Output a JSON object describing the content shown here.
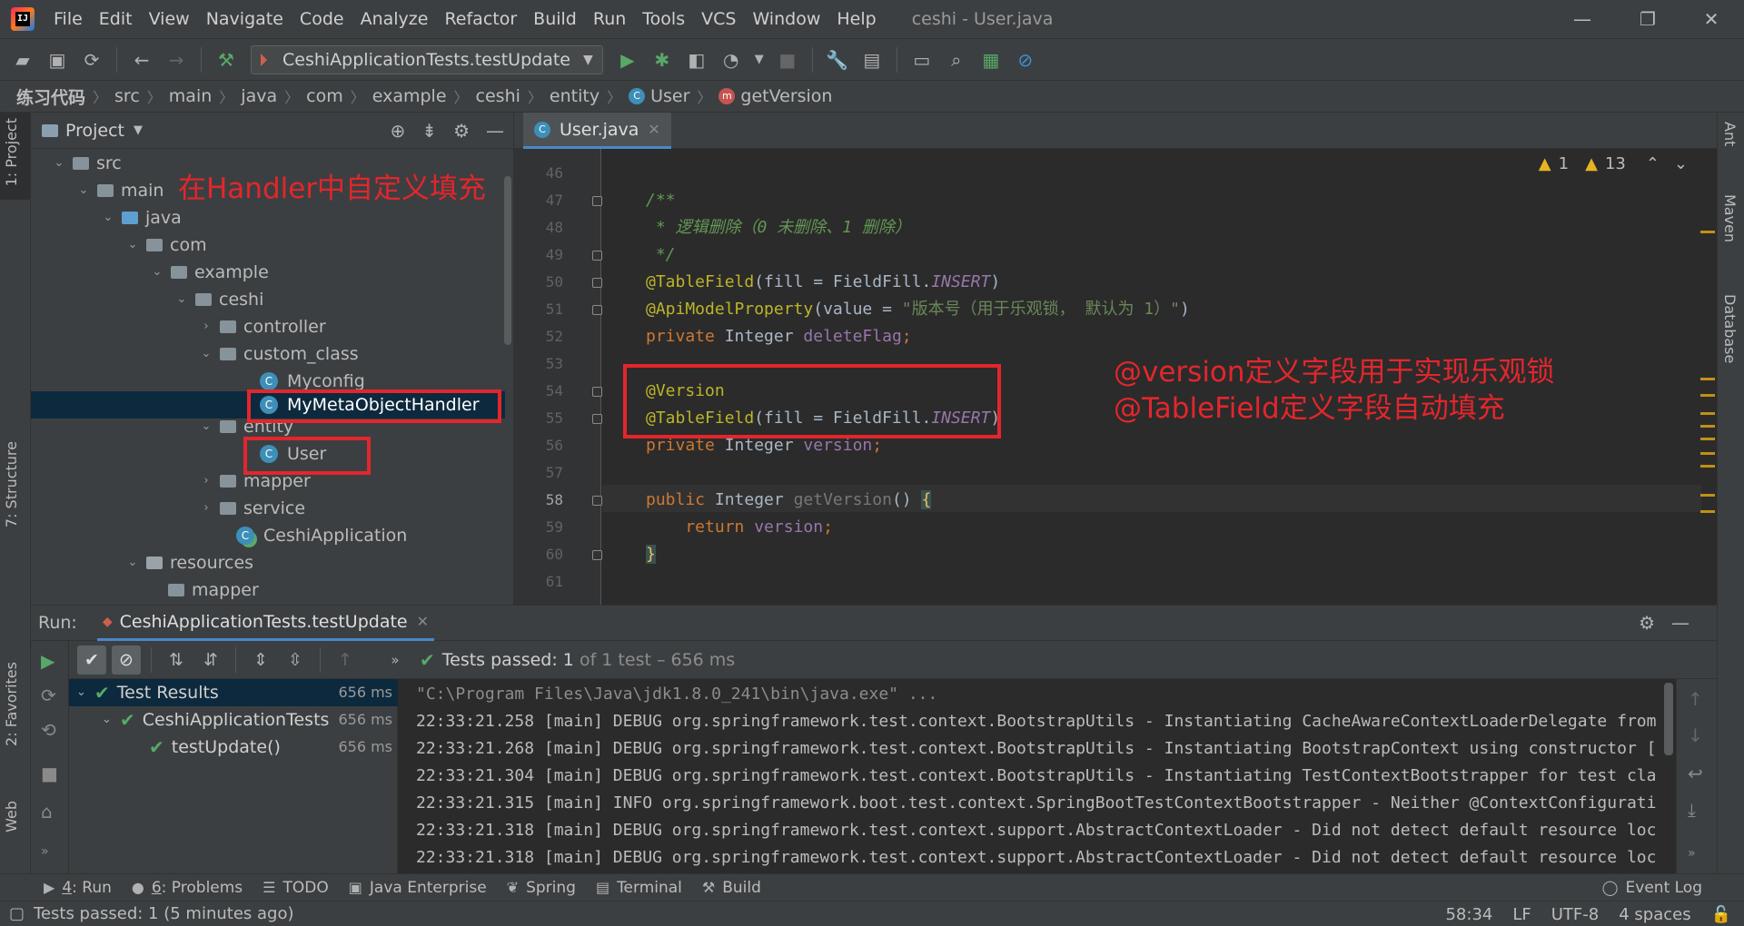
{
  "app": {
    "window_title": "ceshi - User.java",
    "menu": [
      "File",
      "Edit",
      "View",
      "Navigate",
      "Code",
      "Analyze",
      "Refactor",
      "Build",
      "Run",
      "Tools",
      "VCS",
      "Window",
      "Help"
    ],
    "window_controls": [
      "—",
      "❐",
      "✕"
    ]
  },
  "toolbar": {
    "run_config": "CeshiApplicationTests.testUpdate"
  },
  "breadcrumb": [
    "练习代码",
    "src",
    "main",
    "java",
    "com",
    "example",
    "ceshi",
    "entity",
    "User",
    "getVersion"
  ],
  "project": {
    "title": "Project",
    "tree": [
      {
        "label": "src",
        "arrow": "⌄"
      },
      {
        "label": "main",
        "arrow": "⌄"
      },
      {
        "label": "java",
        "arrow": "⌄"
      },
      {
        "label": "com",
        "arrow": "⌄"
      },
      {
        "label": "example",
        "arrow": "⌄"
      },
      {
        "label": "ceshi",
        "arrow": "⌄"
      },
      {
        "label": "controller",
        "arrow": "›"
      },
      {
        "label": "custom_class",
        "arrow": "⌄"
      },
      {
        "label": "Myconfig"
      },
      {
        "label": "MyMetaObjectHandler"
      },
      {
        "label": "entity",
        "arrow": "⌄"
      },
      {
        "label": "User"
      },
      {
        "label": "mapper",
        "arrow": "›"
      },
      {
        "label": "service",
        "arrow": "›"
      },
      {
        "label": "CeshiApplication"
      },
      {
        "label": "resources",
        "arrow": "⌄"
      },
      {
        "label": "mapper"
      }
    ],
    "annotation": "在Handler中自定义填充"
  },
  "editor": {
    "tab": "User.java",
    "inspections": {
      "warn1": "1",
      "warn2": "13"
    },
    "line_numbers": [
      "46",
      "47",
      "48",
      "49",
      "50",
      "51",
      "52",
      "53",
      "54",
      "55",
      "56",
      "57",
      "58",
      "59",
      "60",
      "61"
    ],
    "current_line": "58",
    "annotation_lines": [
      "@version定义字段用于实现乐观锁",
      "@TableField定义字段自动填充"
    ],
    "code": {
      "l47": "/**",
      "l48": " * 逻辑删除（0 未删除、1 删除）",
      "l49": " */",
      "l50_a": "@TableField",
      "l50_b": "(fill = FieldFill.",
      "l50_c": "INSERT",
      "l50_d": ")",
      "l51_a": "@ApiModelProperty",
      "l51_b": "(value = ",
      "l51_c": "\"版本号（用于乐观锁， 默认为 1）\"",
      "l51_d": ")",
      "l52_a": "private ",
      "l52_b": "Integer ",
      "l52_c": "deleteFlag",
      "l52_d": ";",
      "l54": "@Version",
      "l55_a": "@TableField",
      "l55_b": "(fill = FieldFill.",
      "l55_c": "INSERT",
      "l55_d": ")",
      "l56_a": "private ",
      "l56_b": "Integer ",
      "l56_c": "version",
      "l56_d": ";",
      "l58_a": "public ",
      "l58_b": "Integer ",
      "l58_c": "getVersion",
      "l58_d": "() ",
      "l58_e": "{",
      "l59_a": "    return ",
      "l59_b": "version",
      "l59_c": ";",
      "l60": "}"
    }
  },
  "run": {
    "label": "Run:",
    "tab": "CeshiApplicationTests.testUpdate",
    "status_bold": "Tests passed: 1",
    "status_rest": " of 1 test – 656 ms",
    "tests": [
      {
        "label": "Test Results",
        "time": "656 ms"
      },
      {
        "label": "CeshiApplicationTests",
        "time": "656 ms"
      },
      {
        "label": "testUpdate()",
        "time": "656 ms"
      }
    ],
    "console": [
      "\"C:\\Program Files\\Java\\jdk1.8.0_241\\bin\\java.exe\" ...",
      "22:33:21.258 [main] DEBUG org.springframework.test.context.BootstrapUtils - Instantiating CacheAwareContextLoaderDelegate from",
      "22:33:21.268 [main] DEBUG org.springframework.test.context.BootstrapUtils - Instantiating BootstrapContext using constructor [",
      "22:33:21.304 [main] DEBUG org.springframework.test.context.BootstrapUtils - Instantiating TestContextBootstrapper for test cla",
      "22:33:21.315 [main] INFO org.springframework.boot.test.context.SpringBootTestContextBootstrapper - Neither @ContextConfigurati",
      "22:33:21.318 [main] DEBUG org.springframework.test.context.support.AbstractContextLoader - Did not detect default resource loc",
      "22:33:21.318 [main] DEBUG org.springframework.test.context.support.AbstractContextLoader - Did not detect default resource loc"
    ]
  },
  "left_strip": {
    "project": "1: Project",
    "structure": "7: Structure",
    "favorites": "2: Favorites",
    "web": "Web"
  },
  "right_strip": {
    "ant": "Ant",
    "maven": "Maven",
    "database": "Database"
  },
  "bottom_tabs": [
    {
      "num": "4",
      "label": ": Run"
    },
    {
      "num": "6",
      "label": ": Problems"
    },
    {
      "num": "",
      "label": "TODO"
    },
    {
      "num": "",
      "label": "Java Enterprise"
    },
    {
      "num": "",
      "label": "Spring"
    },
    {
      "num": "",
      "label": "Terminal"
    },
    {
      "num": "",
      "label": "Build"
    }
  ],
  "event_log": "Event Log",
  "status": {
    "message": "Tests passed: 1 (5 minutes ago)",
    "position": "58:34",
    "line_sep": "LF",
    "encoding": "UTF-8",
    "indent": "4 spaces"
  },
  "colors": {
    "annotation_red": "#e3262c",
    "accent_blue": "#4a88c7",
    "ok_green": "#59a869"
  }
}
